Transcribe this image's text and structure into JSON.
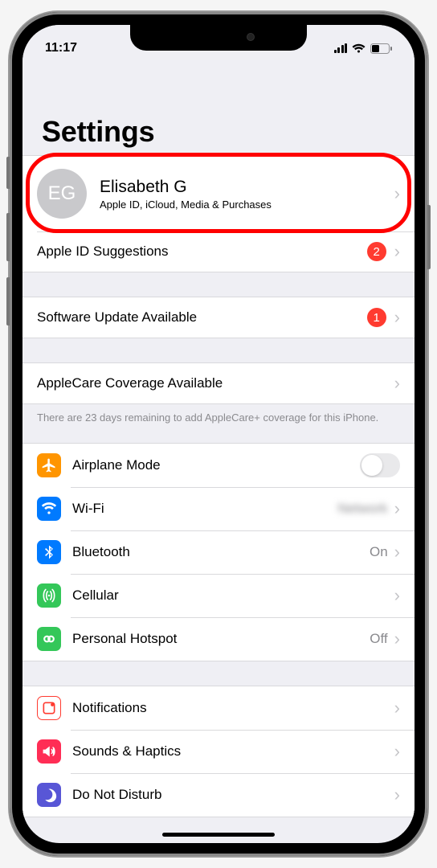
{
  "status": {
    "time": "11:17"
  },
  "header": {
    "title": "Settings"
  },
  "profile": {
    "initials": "EG",
    "name": "Elisabeth G",
    "subtitle": "Apple ID, iCloud, Media & Purchases"
  },
  "rows": {
    "apple_id_suggestions": {
      "label": "Apple ID Suggestions",
      "badge": "2"
    },
    "software_update": {
      "label": "Software Update Available",
      "badge": "1"
    },
    "applecare": {
      "label": "AppleCare Coverage Available"
    },
    "applecare_note": "There are 23 days remaining to add AppleCare+ coverage for this iPhone.",
    "airplane": {
      "label": "Airplane Mode"
    },
    "wifi": {
      "label": "Wi-Fi",
      "value": "Network"
    },
    "bluetooth": {
      "label": "Bluetooth",
      "value": "On"
    },
    "cellular": {
      "label": "Cellular"
    },
    "hotspot": {
      "label": "Personal Hotspot",
      "value": "Off"
    },
    "notifications": {
      "label": "Notifications"
    },
    "sounds": {
      "label": "Sounds & Haptics"
    },
    "dnd": {
      "label": "Do Not Disturb"
    }
  },
  "colors": {
    "badge": "#ff3b30",
    "highlight": "#ff0000"
  }
}
